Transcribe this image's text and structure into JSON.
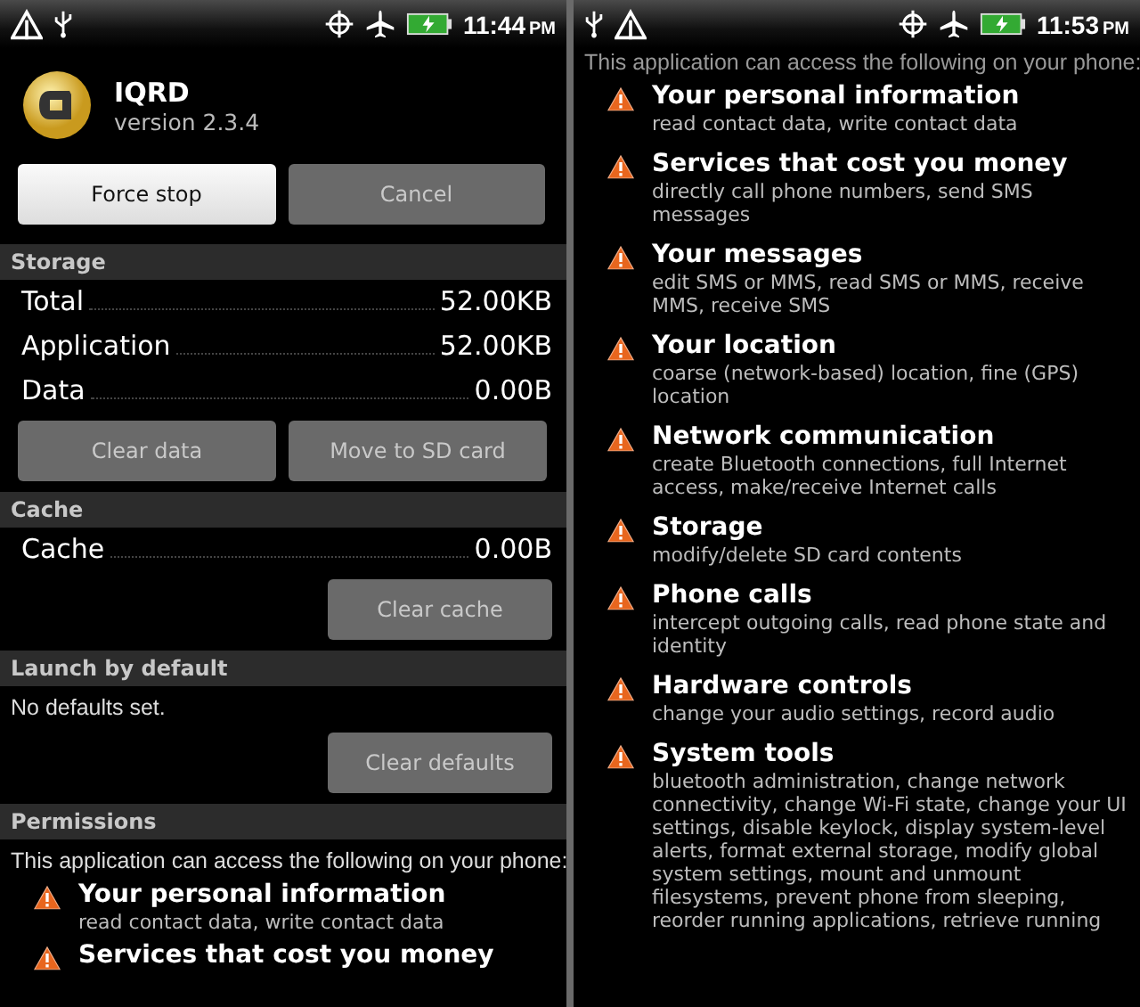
{
  "left_screen": {
    "status_bar": {
      "time": "11:44",
      "meridiem": "PM"
    },
    "app": {
      "name": "IQRD",
      "version": "version 2.3.4"
    },
    "top_buttons": [
      {
        "label": "Force stop",
        "disabled": false
      },
      {
        "label": "Cancel",
        "disabled": true
      }
    ],
    "sections": [
      {
        "title": "Storage",
        "items": [
          {
            "kind": "row",
            "label": "Total",
            "value": "52.00KB"
          },
          {
            "kind": "row",
            "label": "Application",
            "value": "52.00KB"
          },
          {
            "kind": "row",
            "label": "Data",
            "value": "0.00B"
          },
          {
            "kind": "buttons",
            "buttons": [
              {
                "label": "Clear data",
                "disabled": true
              },
              {
                "label": "Move to SD card",
                "disabled": true
              }
            ]
          }
        ]
      },
      {
        "title": "Cache",
        "items": [
          {
            "kind": "row",
            "label": "Cache",
            "value": "0.00B"
          },
          {
            "kind": "buttons",
            "buttons": [
              {
                "label": "Clear cache",
                "disabled": true
              }
            ]
          }
        ]
      },
      {
        "title": "Launch by default",
        "items": [
          {
            "kind": "text",
            "text": "No defaults set."
          },
          {
            "kind": "buttons",
            "buttons": [
              {
                "label": "Clear defaults",
                "disabled": true
              }
            ]
          }
        ]
      },
      {
        "title": "Permissions",
        "items": [
          {
            "kind": "text",
            "text": "This application can access the following on your phone:"
          },
          {
            "kind": "permission",
            "title": "Your personal information",
            "description": "read contact data, write contact data"
          },
          {
            "kind": "permission",
            "title": "Services that cost you money"
          }
        ]
      }
    ]
  },
  "right_screen": {
    "status_bar": {
      "time": "11:53",
      "meridiem": "PM"
    },
    "intro": "This application can access the following on your phone:",
    "permissions": [
      {
        "title": "Your personal information",
        "description": "read contact data, write contact data"
      },
      {
        "title": "Services that cost you money",
        "description": "directly call phone numbers, send SMS messages"
      },
      {
        "title": "Your messages",
        "description": "edit SMS or MMS, read SMS or MMS, receive MMS, receive SMS"
      },
      {
        "title": "Your location",
        "description": "coarse (network-based) location, fine (GPS) location"
      },
      {
        "title": "Network communication",
        "description": "create Bluetooth connections, full Internet access, make/receive Internet calls"
      },
      {
        "title": "Storage",
        "description": "modify/delete SD card contents"
      },
      {
        "title": "Phone calls",
        "description": "intercept outgoing calls, read phone state and identity"
      },
      {
        "title": "Hardware controls",
        "description": "change your audio settings, record audio"
      },
      {
        "title": "System tools",
        "description": "bluetooth administration, change network connectivity, change Wi-Fi state, change your UI settings, disable keylock, display system-level alerts, format external storage, modify global system settings, mount and unmount filesystems, prevent phone from sleeping, reorder running applications, retrieve running"
      }
    ]
  }
}
